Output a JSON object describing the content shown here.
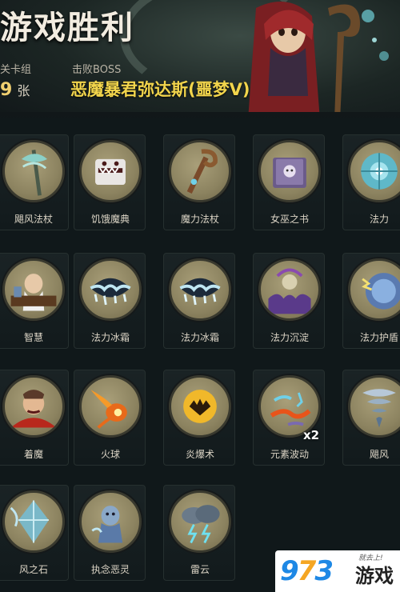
{
  "header": {
    "title": "游戏胜利",
    "deck_label": "关卡组",
    "deck_count": "9",
    "deck_unit": "张",
    "boss_label": "击败BOSS",
    "boss_name": "恶魔暴君弥达斯(噩梦V)"
  },
  "cards": [
    {
      "label": "飓风法杖",
      "icon": "cyclone-staff-icon",
      "col": 0,
      "row": 0
    },
    {
      "label": "饥饿魔典",
      "icon": "hungry-grimoire-icon",
      "col": 1,
      "row": 0
    },
    {
      "label": "魔力法杖",
      "icon": "magic-staff-icon",
      "col": 2,
      "row": 0
    },
    {
      "label": "女巫之书",
      "icon": "witch-book-icon",
      "col": 3,
      "row": 0
    },
    {
      "label": "法力",
      "icon": "mana-icon",
      "col": 4,
      "row": 0
    },
    {
      "label": "智慧",
      "icon": "wisdom-icon",
      "col": 0,
      "row": 1
    },
    {
      "label": "法力冰霜",
      "icon": "mana-frost-icon",
      "col": 1,
      "row": 1
    },
    {
      "label": "法力冰霜",
      "icon": "mana-frost-icon",
      "col": 2,
      "row": 1
    },
    {
      "label": "法力沉淀",
      "icon": "mana-sediment-icon",
      "col": 3,
      "row": 1
    },
    {
      "label": "法力护盾",
      "icon": "mana-shield-icon",
      "col": 4,
      "row": 1
    },
    {
      "label": "着魔",
      "icon": "possessed-icon",
      "col": 0,
      "row": 2
    },
    {
      "label": "火球",
      "icon": "fireball-icon",
      "col": 1,
      "row": 2
    },
    {
      "label": "炎爆术",
      "icon": "pyroblast-icon",
      "col": 2,
      "row": 2
    },
    {
      "label": "元素波动",
      "icon": "elemental-wave-icon",
      "col": 3,
      "row": 2,
      "count": "x2"
    },
    {
      "label": "飓风",
      "icon": "cyclone-icon",
      "col": 4,
      "row": 2
    },
    {
      "label": "风之石",
      "icon": "wind-stone-icon",
      "col": 0,
      "row": 3
    },
    {
      "label": "执念恶灵",
      "icon": "obsessed-ghost-icon",
      "col": 1,
      "row": 3
    },
    {
      "label": "雷云",
      "icon": "thundercloud-icon",
      "col": 2,
      "row": 3
    }
  ],
  "watermark": {
    "digit1": "9",
    "digit2": "7",
    "digit3": "3",
    "word": "游戏",
    "slogan": "就去上!"
  },
  "colors": {
    "boss_name": "#f2d54c",
    "card_circle": "#a99f79",
    "background": "#10181a"
  }
}
